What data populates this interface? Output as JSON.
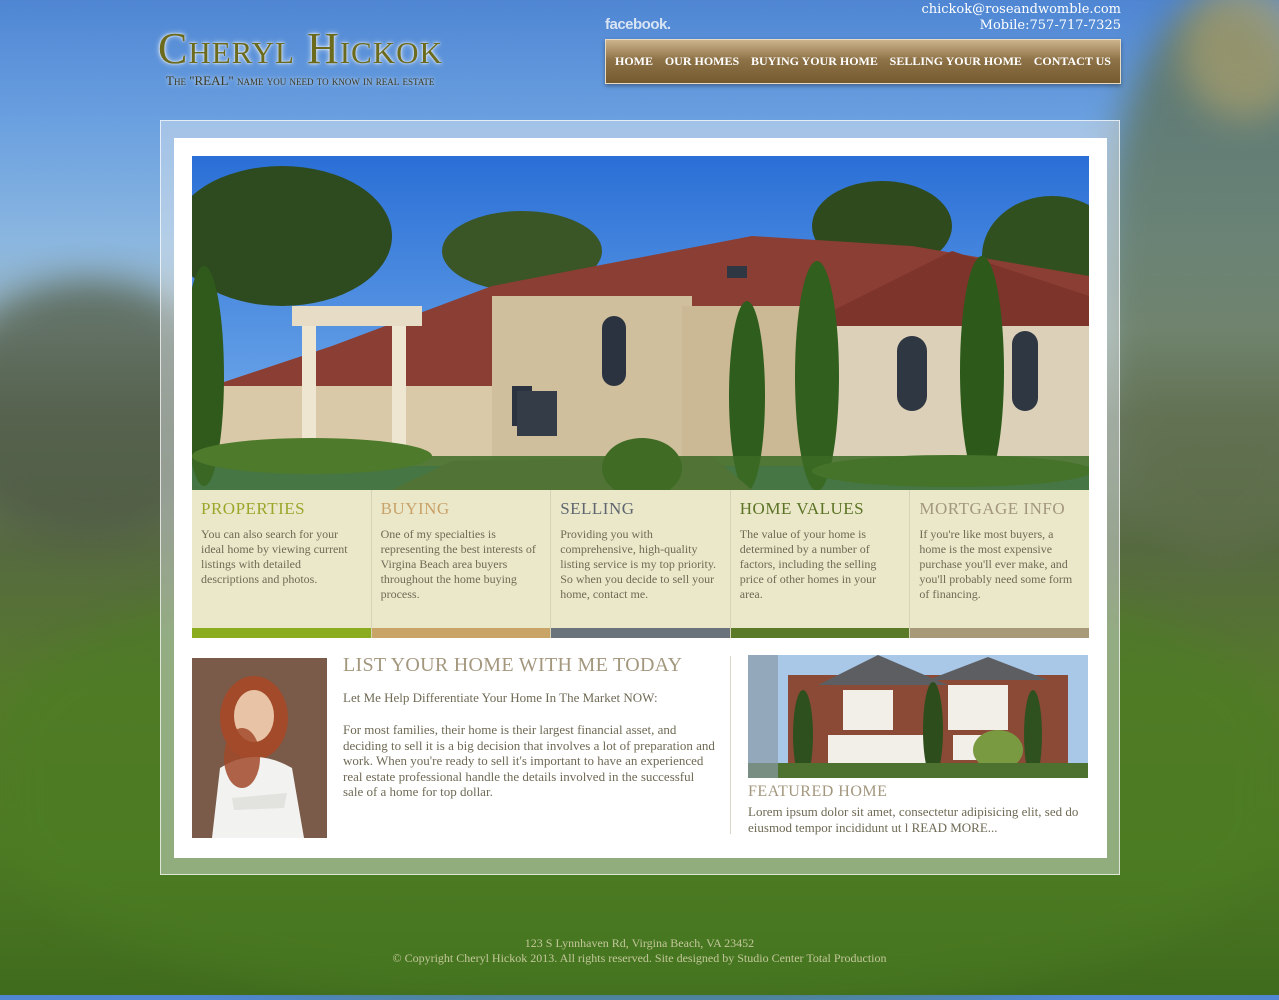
{
  "header": {
    "logo_name": "Cheryl Hickok",
    "logo_tagline": "The \"REAL\" name you need to know in real estate",
    "facebook_label": "facebook.",
    "email": "chickok@roseandwomble.com",
    "mobile": "Mobile:757-717-7325"
  },
  "nav": {
    "items": [
      "HOME",
      "OUR HOMES",
      "BUYING YOUR HOME",
      "SELLING YOUR HOME",
      "CONTACT US"
    ]
  },
  "features": [
    {
      "title": "PROPERTIES",
      "text": "You can also search for your ideal home by viewing current listings with detailed descriptions and photos.",
      "color": "#9aa72a",
      "bar": "#8aac1e"
    },
    {
      "title": "BUYING",
      "text": "One of my specialties is representing the best interests of Virgina Beach area buyers throughout the home buying process.",
      "color": "#c9a26a",
      "bar": "#c9a467"
    },
    {
      "title": "SELLING",
      "text": "Providing you with comprehensive, high-quality listing service is my top priority. So when you decide to sell your home, contact me.",
      "color": "#5f6670",
      "bar": "#6a727b"
    },
    {
      "title": "HOME VALUES",
      "text": "The value of your home is determined by a number of factors, including the selling price of other homes in your area.",
      "color": "#5b7324",
      "bar": "#5b7a28"
    },
    {
      "title": "MORTGAGE INFO",
      "text": "If you're like most buyers, a home is the most expensive purchase you'll ever make, and you'll probably need some form of financing.",
      "color": "#a3977e",
      "bar": "#a79a79"
    }
  ],
  "list_section": {
    "title": "LIST YOUR HOME WITH ME TODAY",
    "subtitle": "Let Me Help Differentiate Your Home In The Market NOW:",
    "body": "For most families, their home is their largest financial asset, and deciding to sell it is a big decision that involves a lot of preparation and work. When you're ready to sell it's important to have an experienced real estate professional handle the details involved in the successful sale of a home for top dollar."
  },
  "featured": {
    "title": "FEATURED HOME",
    "text": "Lorem ipsum dolor sit amet, consectetur adipisicing elit, sed do eiusmod tempor incididunt ut l",
    "read_more": "READ MORE..."
  },
  "footer": {
    "address": "123 S Lynnhaven Rd, Virgina Beach, VA 23452",
    "copyright": "© Copyright Cheryl Hickok 2013. All rights reserved. Site designed by Studio Center Total Production"
  }
}
